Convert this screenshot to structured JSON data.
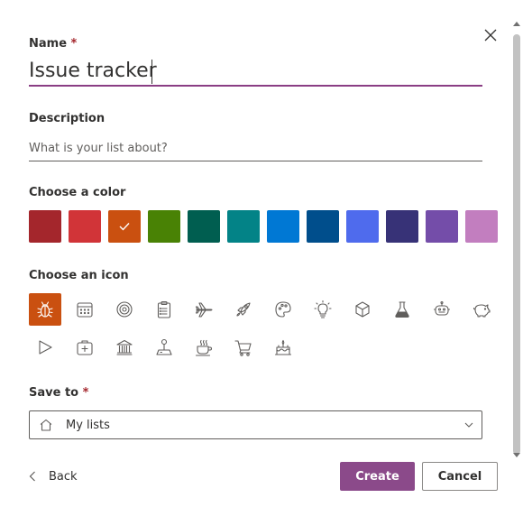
{
  "name": {
    "label": "Name",
    "required": "*",
    "value": "Issue tracker"
  },
  "description": {
    "label": "Description",
    "placeholder": "What is your list about?",
    "value": ""
  },
  "color": {
    "label": "Choose a color",
    "swatches": [
      "#a4262c",
      "#d13438",
      "#ca5010",
      "#498205",
      "#005e50",
      "#038387",
      "#0078d4",
      "#004e8c",
      "#4f6bed",
      "#373277",
      "#744da9",
      "#c27ebf"
    ],
    "selected_index": 2
  },
  "icon": {
    "label": "Choose an icon",
    "selected_icon": "bug-icon",
    "rows": [
      [
        "bug-icon",
        "calendar-icon",
        "target-icon",
        "clipboard-icon",
        "airplane-icon",
        "rocket-icon",
        "palette-icon",
        "lightbulb-icon",
        "cube-icon",
        "flask-icon",
        "robot-icon",
        "piggy-bank-icon"
      ],
      [
        "play-icon",
        "medical-kit-icon",
        "bank-icon",
        "joystick-icon",
        "coffee-cup-icon",
        "shopping-cart-icon",
        "cake-icon"
      ]
    ]
  },
  "save_to": {
    "label": "Save to",
    "required": "*",
    "value": "My lists",
    "icon": "home-icon"
  },
  "footer": {
    "back_label": "Back",
    "create_label": "Create",
    "cancel_label": "Cancel"
  },
  "colors": {
    "accent": "#8b4a8a",
    "required": "#a4262c",
    "icon_stroke": "#605e5c"
  }
}
